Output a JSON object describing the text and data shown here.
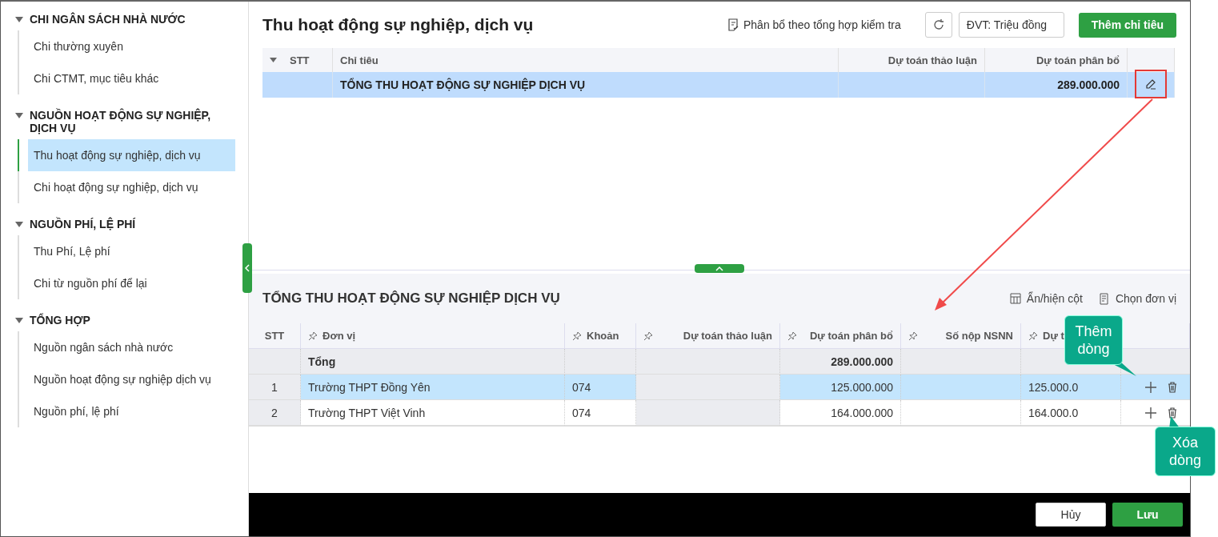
{
  "sidebar": {
    "groups": [
      {
        "title": "CHI NGÂN SÁCH NHÀ NƯỚC",
        "expanded": true,
        "items": [
          {
            "label": "Chi thường xuyên",
            "selected": false
          },
          {
            "label": "Chi CTMT, mục tiêu khác",
            "selected": false
          }
        ]
      },
      {
        "title": "NGUỒN HOẠT ĐỘNG SỰ NGHIỆP, DỊCH VỤ",
        "expanded": true,
        "items": [
          {
            "label": "Thu hoạt động sự nghiệp, dịch vụ",
            "selected": true
          },
          {
            "label": "Chi hoạt động sự nghiệp, dịch vụ",
            "selected": false
          }
        ]
      },
      {
        "title": "NGUỒN PHÍ, LỆ PHÍ",
        "expanded": true,
        "items": [
          {
            "label": "Thu Phí, Lệ phí",
            "selected": false
          },
          {
            "label": "Chi từ nguồn phí để lại",
            "selected": false
          }
        ]
      },
      {
        "title": "TỔNG HỢP",
        "expanded": true,
        "items": [
          {
            "label": "Nguồn ngân sách nhà nước",
            "selected": false
          },
          {
            "label": "Nguồn hoạt động sự nghiệp dịch vụ",
            "selected": false
          },
          {
            "label": "Nguồn phí, lệ phí",
            "selected": false
          }
        ]
      }
    ]
  },
  "top": {
    "title": "Thu hoạt động sự nghiệp, dịch vụ",
    "check_link": "Phân bổ theo tổng hợp kiểm tra",
    "unit_field": {
      "value": "ĐVT: Triệu đồng"
    },
    "add_button": "Thêm chỉ tiêu",
    "table": {
      "columns": [
        "STT",
        "Chỉ tiêu",
        "Dự toán thảo luận",
        "Dự toán phân bổ"
      ],
      "rows": [
        {
          "selected": true,
          "cells": [
            "",
            "TỔNG THU HOẠT ĐỘNG SỰ NGHIỆP DỊCH VỤ",
            "",
            "289.000.000"
          ]
        }
      ]
    }
  },
  "bottom": {
    "title": "TỔNG THU HOẠT ĐỘNG SỰ NGHIỆP DỊCH VỤ",
    "tools": [
      "Ẩn/hiện cột",
      "Chọn đơn vị"
    ],
    "columns": [
      {
        "label": "STT",
        "pinned": false,
        "readonly": true
      },
      {
        "label": "Đơn vị",
        "pinned": true,
        "readonly": false
      },
      {
        "label": "Khoản",
        "pinned": true,
        "readonly": false
      },
      {
        "label": "Dự toán thảo luận",
        "pinned": true,
        "readonly": true
      },
      {
        "label": "Dự toán phân bổ",
        "pinned": true,
        "readonly": false
      },
      {
        "label": "Số nộp NSNN",
        "pinned": true,
        "readonly": false
      },
      {
        "label": "Dự t",
        "pinned": true,
        "readonly": false
      }
    ],
    "rows": [
      {
        "kind": "total",
        "cells": [
          "",
          "Tổng",
          "",
          "",
          "289.000.000",
          "",
          ""
        ]
      },
      {
        "kind": "data",
        "selected": true,
        "cells": [
          "1",
          "Trường THPT Đồng Yên",
          "074",
          "",
          "125.000.000",
          "",
          "125.000.0"
        ]
      },
      {
        "kind": "data",
        "selected": false,
        "cells": [
          "2",
          "Trường THPT Việt Vinh",
          "074",
          "",
          "164.000.000",
          "",
          "164.000.0"
        ]
      }
    ]
  },
  "callouts": [
    {
      "text": "Thêm dòng"
    },
    {
      "text": "Xóa dòng"
    }
  ],
  "footer": {
    "buttons": [
      {
        "label": "Hủy",
        "kind": "secondary"
      },
      {
        "label": "Lưu",
        "kind": "primary"
      }
    ]
  }
}
